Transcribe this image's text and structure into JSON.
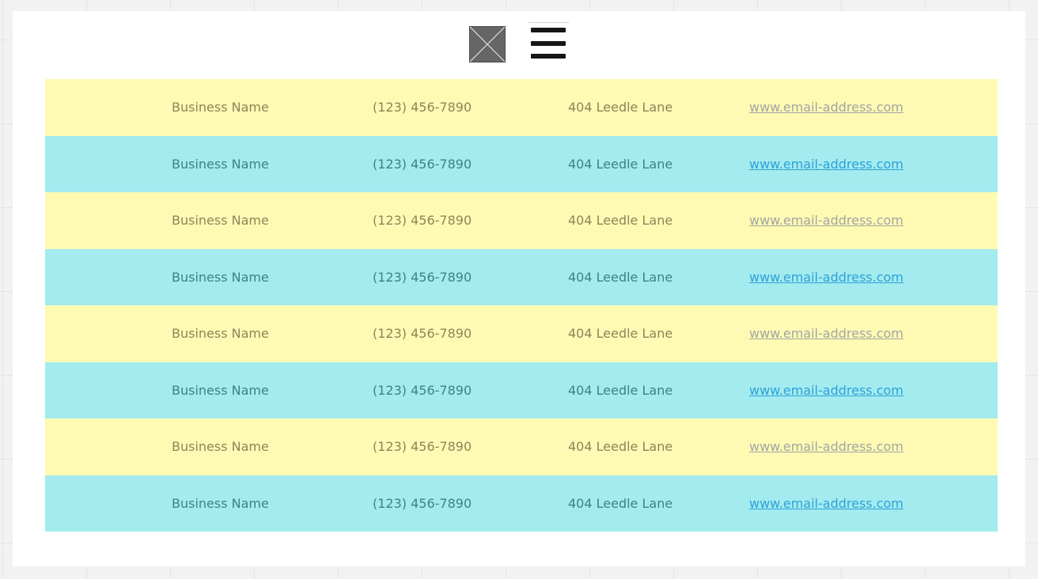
{
  "toolbar": {
    "image_icon": "image-placeholder-icon",
    "menu_icon": "hamburger-menu-icon"
  },
  "colors": {
    "row_yellow": "#fefab4",
    "row_cyan": "#a3ebee",
    "text_yellow_row": "#8b8758",
    "text_cyan_row": "#3f8186",
    "link_yellow_row": "#a3a5a3",
    "link_cyan_row": "#2ea1d9"
  },
  "rows": [
    {
      "name": "Business Name",
      "phone": "(123) 456-7890",
      "address": "404 Leedle Lane",
      "link": "www.email-address.com",
      "style": "yellow"
    },
    {
      "name": "Business Name",
      "phone": "(123) 456-7890",
      "address": "404 Leedle Lane",
      "link": "www.email-address.com",
      "style": "cyan"
    },
    {
      "name": "Business Name",
      "phone": "(123) 456-7890",
      "address": "404 Leedle Lane",
      "link": "www.email-address.com",
      "style": "yellow"
    },
    {
      "name": "Business Name",
      "phone": "(123) 456-7890",
      "address": "404 Leedle Lane",
      "link": "www.email-address.com",
      "style": "cyan"
    },
    {
      "name": "Business Name",
      "phone": "(123) 456-7890",
      "address": "404 Leedle Lane",
      "link": "www.email-address.com",
      "style": "yellow"
    },
    {
      "name": "Business Name",
      "phone": "(123) 456-7890",
      "address": "404 Leedle Lane",
      "link": "www.email-address.com",
      "style": "cyan"
    },
    {
      "name": "Business Name",
      "phone": "(123) 456-7890",
      "address": "404 Leedle Lane",
      "link": "www.email-address.com",
      "style": "yellow"
    },
    {
      "name": "Business Name",
      "phone": "(123) 456-7890",
      "address": "404 Leedle Lane",
      "link": "www.email-address.com",
      "style": "cyan"
    }
  ]
}
